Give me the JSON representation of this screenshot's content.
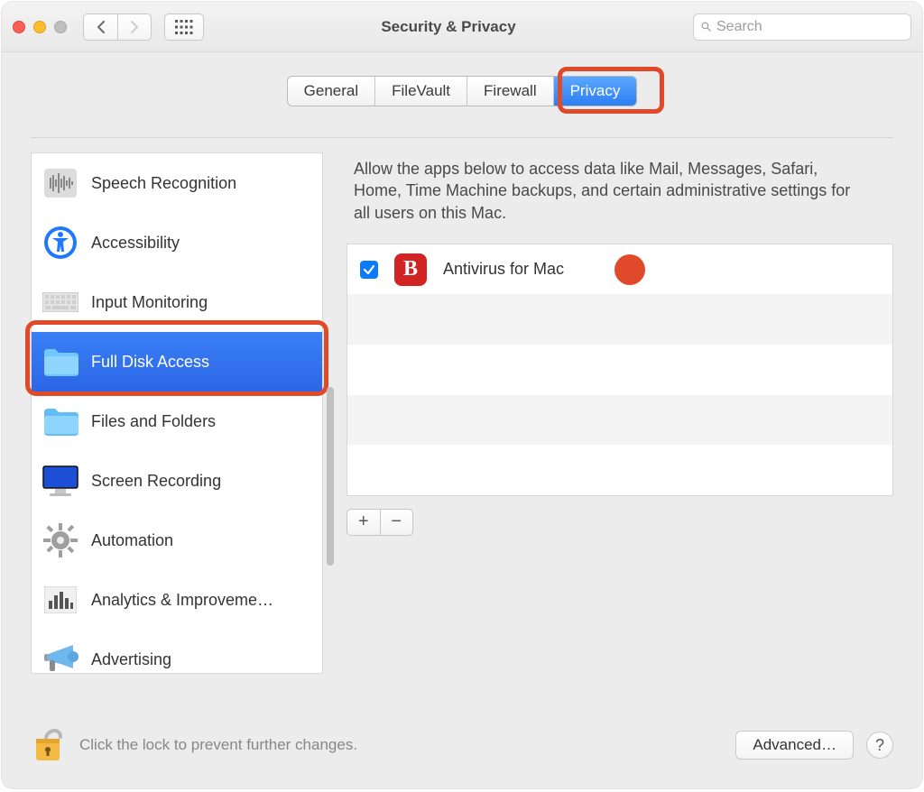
{
  "window": {
    "title": "Security & Privacy"
  },
  "search": {
    "placeholder": "Search"
  },
  "tabs": {
    "items": [
      "General",
      "FileVault",
      "Firewall",
      "Privacy"
    ],
    "active_index": 3
  },
  "sidebar": {
    "items": [
      {
        "label": "Speech Recognition",
        "icon": "waveform-icon"
      },
      {
        "label": "Accessibility",
        "icon": "accessibility-icon"
      },
      {
        "label": "Input Monitoring",
        "icon": "keyboard-icon"
      },
      {
        "label": "Full Disk Access",
        "icon": "folder-icon"
      },
      {
        "label": "Files and Folders",
        "icon": "folder-icon"
      },
      {
        "label": "Screen Recording",
        "icon": "display-icon"
      },
      {
        "label": "Automation",
        "icon": "gear-icon"
      },
      {
        "label": "Analytics & Improveme…",
        "icon": "barchart-icon"
      },
      {
        "label": "Advertising",
        "icon": "megaphone-icon"
      }
    ],
    "selected_index": 3
  },
  "panel": {
    "description": "Allow the apps below to access data like Mail, Messages, Safari, Home, Time Machine backups, and certain administrative settings for all users on this Mac.",
    "apps": [
      {
        "label": "Antivirus for Mac",
        "checked": true,
        "icon_letter": "B"
      }
    ],
    "add_label": "+",
    "remove_label": "−"
  },
  "footer": {
    "lock_text": "Click the lock to prevent further changes.",
    "advanced_label": "Advanced…",
    "help_label": "?"
  }
}
